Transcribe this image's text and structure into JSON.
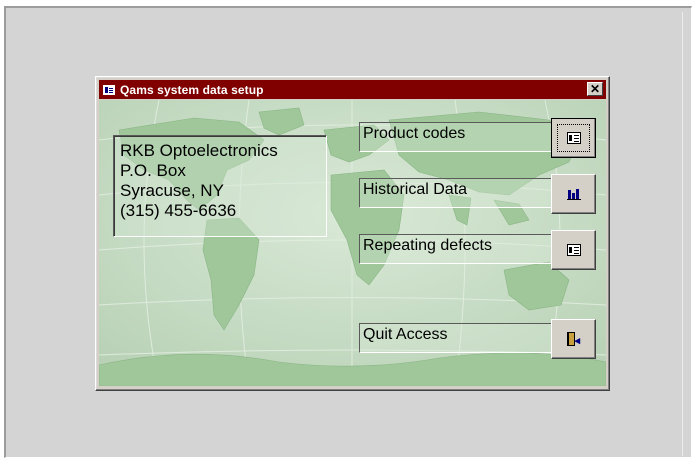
{
  "window": {
    "title": "Qams system data setup",
    "close_glyph": "✕",
    "titlebar_color": "#800000"
  },
  "company": {
    "lines": [
      "RKB Optoelectronics",
      "P.O. Box",
      "Syracuse, NY",
      "(315) 455-6636"
    ]
  },
  "buttons": [
    {
      "label": "Product codes",
      "icon": "form-icon",
      "focused": true
    },
    {
      "label": "Historical Data",
      "icon": "chart-icon",
      "focused": false
    },
    {
      "label": "Repeating defects",
      "icon": "form-icon",
      "focused": false
    },
    {
      "label": "Quit Access",
      "icon": "exit-door-icon",
      "focused": false
    }
  ],
  "colors": {
    "map_land": "#9cc497",
    "map_water": "#c7dcc6",
    "dialog_face": "#d4d0c8"
  }
}
